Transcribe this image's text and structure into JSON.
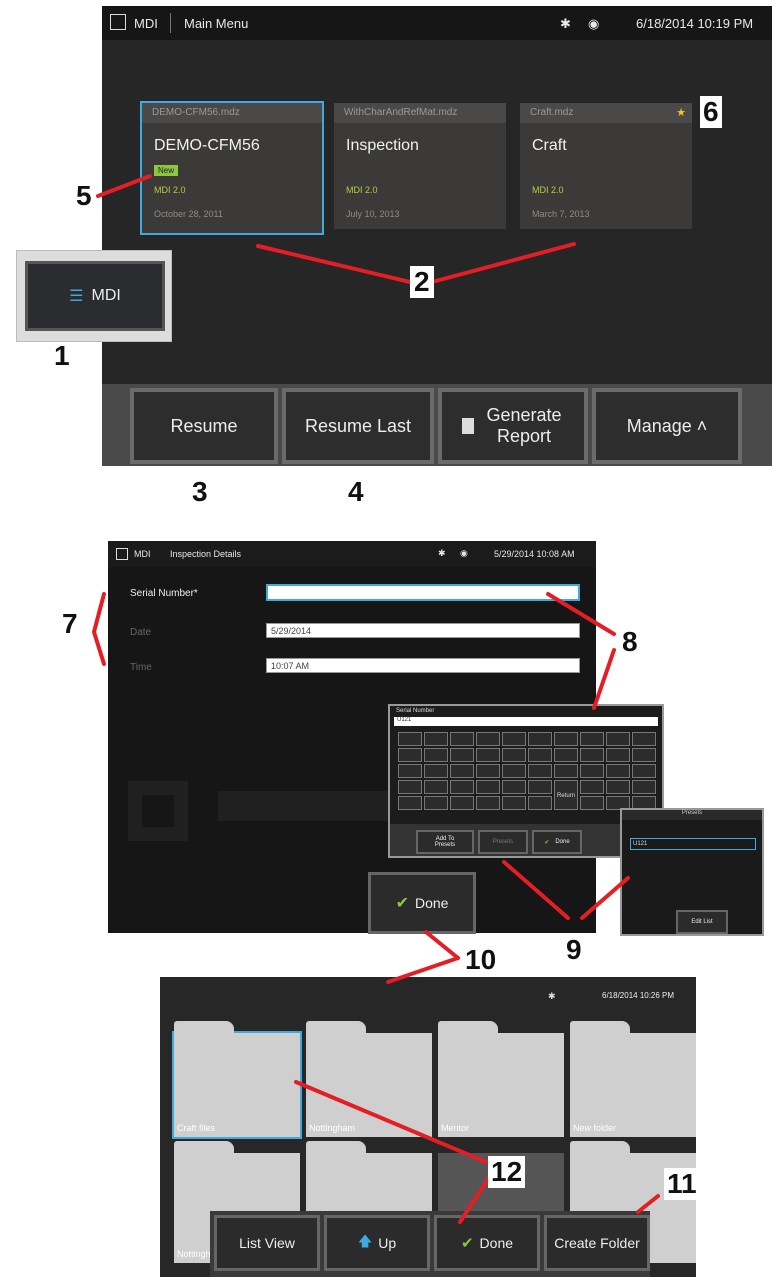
{
  "screen1": {
    "topbar": {
      "app": "MDI",
      "title": "Main Menu",
      "datetime": "6/18/2014  10:19 PM"
    },
    "cards": [
      {
        "file": "DEMO-CFM56.mdz",
        "name": "DEMO-CFM56",
        "badge": "New",
        "version": "MDI 2.0",
        "date": "October 28, 2011"
      },
      {
        "file": "WithCharAndRefMat.mdz",
        "name": "Inspection",
        "version": "MDI 2.0",
        "date": "July 10, 2013"
      },
      {
        "file": "Craft.mdz",
        "name": "Craft",
        "version": "MDI 2.0",
        "date": "March 7, 2013"
      }
    ],
    "buttons": {
      "resume": "Resume",
      "resume_last": "Resume Last",
      "generate_report": "Generate Report",
      "manage": "Manage ˄"
    }
  },
  "mdi_button": {
    "label": "MDI"
  },
  "screen2": {
    "topbar": {
      "app": "MDI",
      "title": "Inspection Details",
      "datetime": "5/29/2014  10:08 AM"
    },
    "fields": [
      {
        "label": "Serial Number*",
        "value": ""
      },
      {
        "label": "Date",
        "value": "5/29/2014"
      },
      {
        "label": "Time",
        "value": "10:07 AM"
      }
    ],
    "done": "Done"
  },
  "keyboard": {
    "title": "Serial Number",
    "value": "U121",
    "add_to_presets": "Add To Presets",
    "presets": "Presets",
    "done": "Done",
    "return_key": "Return"
  },
  "presets_popup": {
    "title": "Presets",
    "item": "U121",
    "edit_list": "Edit List"
  },
  "screen3": {
    "datetime": "6/18/2014  10:26 PM",
    "folders": [
      "Craft files",
      "Nottingham",
      "Mentor",
      "New folder",
      "Nottingh",
      "",
      "",
      ""
    ],
    "buttons": {
      "list_view": "List View",
      "up": "Up",
      "done": "Done",
      "create_folder": "Create Folder"
    }
  },
  "callouts": [
    "1",
    "2",
    "3",
    "4",
    "5",
    "6",
    "7",
    "8",
    "9",
    "10",
    "11",
    "12"
  ],
  "colors": {
    "accent_blue": "#3fa9e0",
    "callout_red": "#e31e24",
    "version_green": "#b6cf3a",
    "badge_green": "#8dc63f"
  }
}
